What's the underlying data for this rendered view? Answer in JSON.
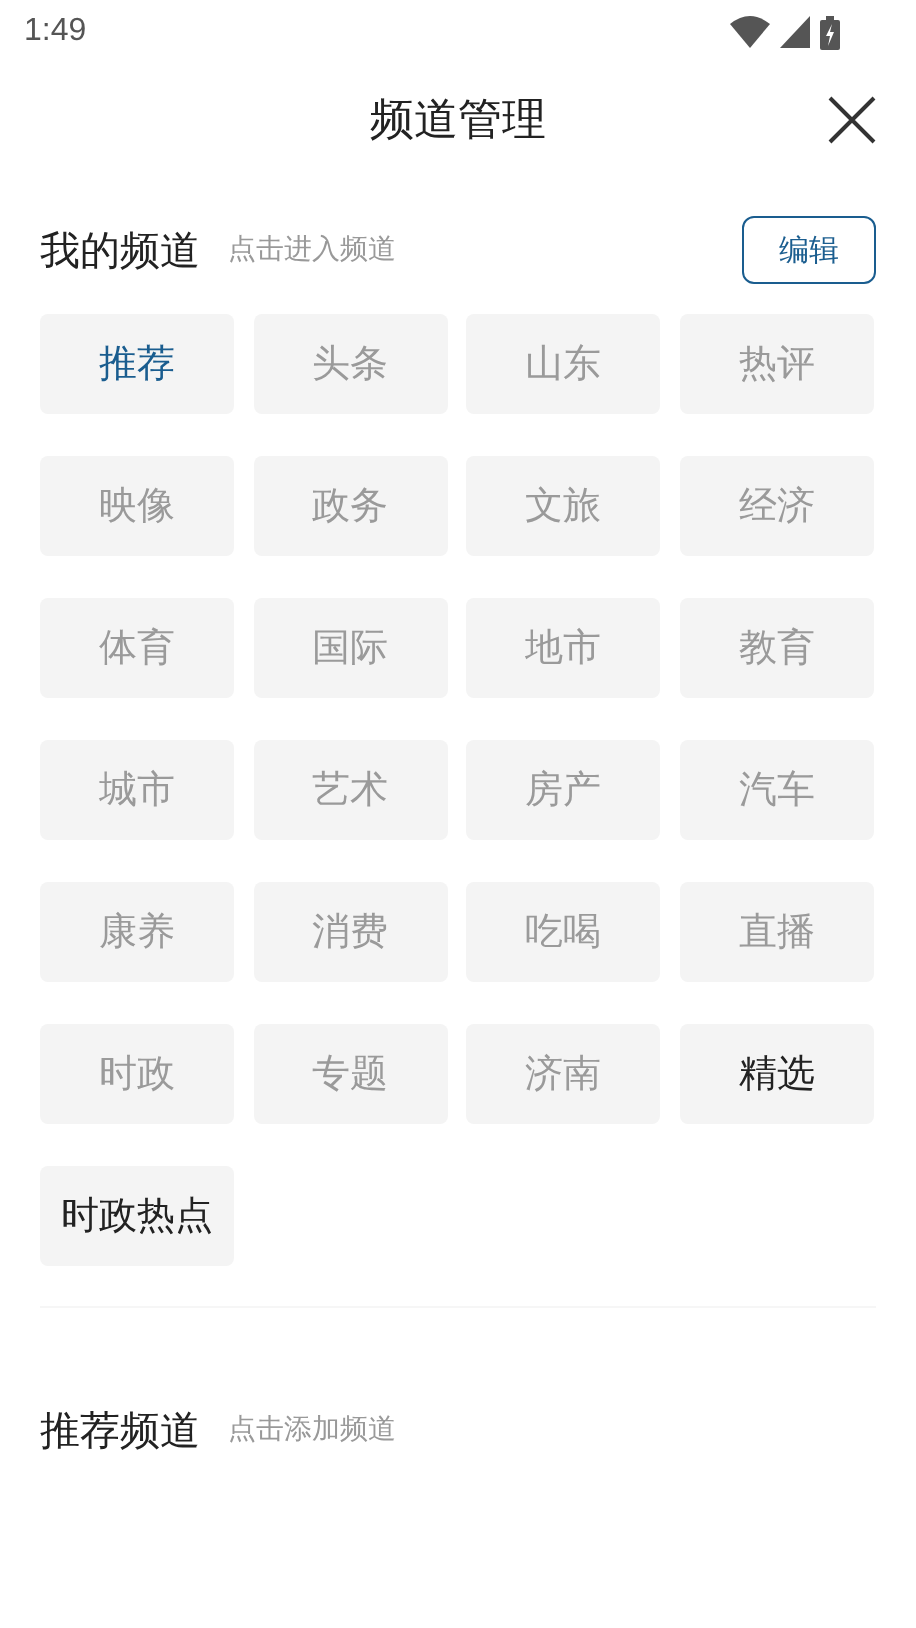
{
  "status_bar": {
    "time": "1:49"
  },
  "header": {
    "title": "频道管理"
  },
  "my_channels": {
    "title": "我的频道",
    "hint": "点击进入频道",
    "edit_button": "编辑",
    "channels": [
      {
        "label": "推荐",
        "selected": true,
        "fixed": true
      },
      {
        "label": "头条",
        "selected": false,
        "fixed": true
      },
      {
        "label": "山东",
        "selected": false,
        "fixed": true
      },
      {
        "label": "热评",
        "selected": false,
        "fixed": true
      },
      {
        "label": "映像",
        "selected": false,
        "fixed": true
      },
      {
        "label": "政务",
        "selected": false,
        "fixed": true
      },
      {
        "label": "文旅",
        "selected": false,
        "fixed": true
      },
      {
        "label": "经济",
        "selected": false,
        "fixed": true
      },
      {
        "label": "体育",
        "selected": false,
        "fixed": true
      },
      {
        "label": "国际",
        "selected": false,
        "fixed": true
      },
      {
        "label": "地市",
        "selected": false,
        "fixed": true
      },
      {
        "label": "教育",
        "selected": false,
        "fixed": true
      },
      {
        "label": "城市",
        "selected": false,
        "fixed": true
      },
      {
        "label": "艺术",
        "selected": false,
        "fixed": true
      },
      {
        "label": "房产",
        "selected": false,
        "fixed": true
      },
      {
        "label": "汽车",
        "selected": false,
        "fixed": true
      },
      {
        "label": "康养",
        "selected": false,
        "fixed": true
      },
      {
        "label": "消费",
        "selected": false,
        "fixed": true
      },
      {
        "label": "吃喝",
        "selected": false,
        "fixed": true
      },
      {
        "label": "直播",
        "selected": false,
        "fixed": true
      },
      {
        "label": "时政",
        "selected": false,
        "fixed": true
      },
      {
        "label": "专题",
        "selected": false,
        "fixed": true
      },
      {
        "label": "济南",
        "selected": false,
        "fixed": true
      },
      {
        "label": "精选",
        "selected": false,
        "fixed": false
      },
      {
        "label": "时政热点",
        "selected": false,
        "fixed": false
      }
    ]
  },
  "recommended_channels": {
    "title": "推荐频道",
    "hint": "点击添加频道"
  }
}
